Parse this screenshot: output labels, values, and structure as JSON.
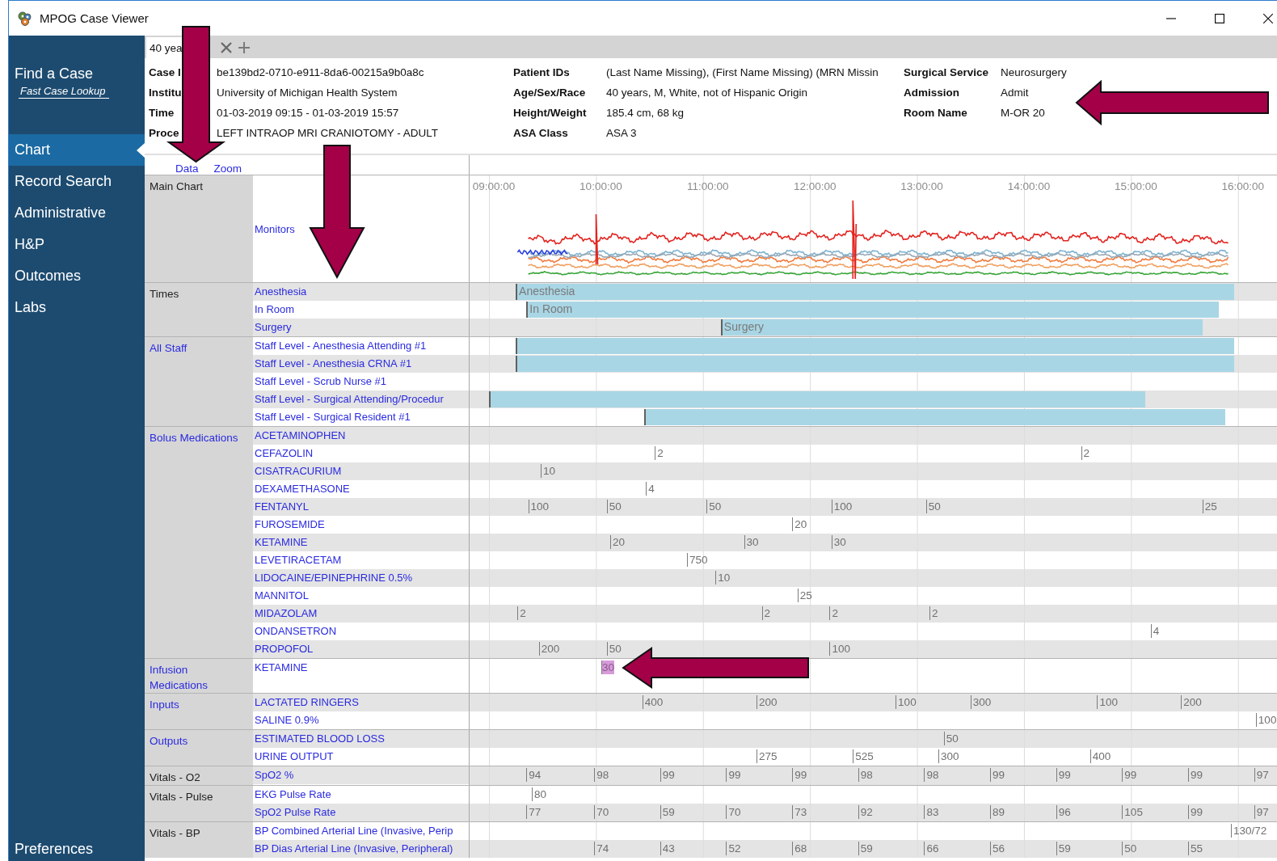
{
  "window": {
    "title": "MPOG Case Viewer"
  },
  "sidebar": {
    "find": {
      "label": "Find a Case",
      "link": "Fast Case Lookup"
    },
    "items": [
      {
        "label": "Chart",
        "selected": true
      },
      {
        "label": "Record Search",
        "selected": false
      },
      {
        "label": "Administrative",
        "selected": false
      },
      {
        "label": "H&P",
        "selected": false
      },
      {
        "label": "Outcomes",
        "selected": false
      },
      {
        "label": "Labs",
        "selected": false
      }
    ],
    "footer": "Preferences"
  },
  "tabs": [
    {
      "label": "40 yea",
      "selected": true
    }
  ],
  "header": {
    "columns": [
      [
        {
          "label": "Case I",
          "value": "be139bd2-0710-e911-8da6-00215a9b0a8c"
        },
        {
          "label": "Institu",
          "value": "University of Michigan Health System"
        },
        {
          "label": "Time",
          "value": "01-03-2019 09:15 - 01-03-2019 15:57"
        },
        {
          "label": "Proce",
          "value": "LEFT INTRAOP MRI CRANIOTOMY - ADULT"
        }
      ],
      [
        {
          "label": "Patient IDs",
          "value": "(Last Name Missing), (First Name Missing) (MRN Missin"
        },
        {
          "label": "Age/Sex/Race",
          "value": "40 years, M, White, not of Hispanic Origin"
        },
        {
          "label": "Height/Weight",
          "value": "185.4 cm, 68 kg"
        },
        {
          "label": "ASA Class",
          "value": "ASA 3"
        }
      ],
      [
        {
          "label": "Surgical Service",
          "value": "Neurosurgery"
        },
        {
          "label": "Admission",
          "value": "Admit"
        },
        {
          "label": "Room Name",
          "value": "M-OR 20"
        }
      ]
    ]
  },
  "chart": {
    "links": [
      "Data",
      "Zoom"
    ],
    "axis": [
      "09:00:00",
      "10:00:00",
      "11:00:00",
      "12:00:00",
      "13:00:00",
      "14:00:00",
      "15:00:00",
      "16:00:00"
    ],
    "main": {
      "group": "Main Chart",
      "label": "Monitors"
    },
    "groups": [
      {
        "name": "Times",
        "clickable": false,
        "rows": [
          {
            "label": "Anesthesia",
            "kind": "interval",
            "text": "Anesthesia"
          },
          {
            "label": "In Room",
            "kind": "interval",
            "text": "In Room"
          },
          {
            "label": "Surgery",
            "kind": "interval",
            "text": "Surgery"
          }
        ]
      },
      {
        "name": "All Staff",
        "clickable": true,
        "rows": [
          {
            "label": "Staff Level - Anesthesia Attending #1",
            "kind": "interval"
          },
          {
            "label": "Staff Level - Anesthesia CRNA #1",
            "kind": "interval"
          },
          {
            "label": "Staff Level - Scrub Nurse #1",
            "kind": "events"
          },
          {
            "label": "Staff Level - Surgical Attending/Procedur",
            "kind": "interval"
          },
          {
            "label": "Staff Level - Surgical Resident #1",
            "kind": "interval"
          }
        ]
      },
      {
        "name": "Bolus Medications",
        "clickable": true,
        "rows": [
          {
            "label": "ACETAMINOPHEN",
            "kind": "events"
          },
          {
            "label": "CEFAZOLIN",
            "kind": "events",
            "values": [
              "2",
              "2"
            ]
          },
          {
            "label": "CISATRACURIUM",
            "kind": "events",
            "values": [
              "10"
            ]
          },
          {
            "label": "DEXAMETHASONE",
            "kind": "events",
            "values": [
              "4"
            ]
          },
          {
            "label": "FENTANYL",
            "kind": "events",
            "values": [
              "100",
              "50",
              "50",
              "100",
              "50",
              "25"
            ]
          },
          {
            "label": "FUROSEMIDE",
            "kind": "events",
            "values": [
              "20"
            ]
          },
          {
            "label": "KETAMINE",
            "kind": "events",
            "values": [
              "20",
              "30",
              "30"
            ]
          },
          {
            "label": "LEVETIRACETAM",
            "kind": "events",
            "values": [
              "750"
            ]
          },
          {
            "label": "LIDOCAINE/EPINEPHRINE 0.5%",
            "kind": "events",
            "values": [
              "10"
            ]
          },
          {
            "label": "MANNITOL",
            "kind": "events",
            "values": [
              "25"
            ]
          },
          {
            "label": "MIDAZOLAM",
            "kind": "events",
            "values": [
              "2",
              "2",
              "2",
              "2"
            ]
          },
          {
            "label": "ONDANSETRON",
            "kind": "events",
            "values": [
              "4"
            ]
          },
          {
            "label": "PROPOFOL",
            "kind": "events",
            "values": [
              "200",
              "50",
              "100"
            ]
          }
        ]
      },
      {
        "name": "Infusion Medications",
        "clickable": true,
        "rows": [
          {
            "label": "KETAMINE",
            "kind": "infusion",
            "values": [
              "30"
            ]
          }
        ]
      },
      {
        "name": "Inputs",
        "clickable": true,
        "rows": [
          {
            "label": "LACTATED RINGERS",
            "kind": "events",
            "values": [
              "400",
              "200",
              "100",
              "300",
              "100",
              "200"
            ]
          },
          {
            "label": "SALINE 0.9%",
            "kind": "events",
            "values": [
              "100"
            ]
          }
        ]
      },
      {
        "name": "Outputs",
        "clickable": true,
        "rows": [
          {
            "label": "ESTIMATED BLOOD LOSS",
            "kind": "events",
            "values": [
              "50"
            ]
          },
          {
            "label": "URINE OUTPUT",
            "kind": "events",
            "values": [
              "275",
              "525",
              "300",
              "400"
            ]
          }
        ]
      },
      {
        "name": "Vitals - O2",
        "clickable": false,
        "rows": [
          {
            "label": "SpO2 %",
            "kind": "events",
            "values": [
              "94",
              "98",
              "99",
              "99",
              "99",
              "98",
              "98",
              "99",
              "99",
              "99",
              "99",
              "97"
            ]
          }
        ]
      },
      {
        "name": "Vitals - Pulse",
        "clickable": false,
        "rows": [
          {
            "label": "EKG Pulse Rate",
            "kind": "events",
            "values": [
              "80"
            ]
          },
          {
            "label": "SpO2 Pulse Rate",
            "kind": "events",
            "values": [
              "77",
              "70",
              "59",
              "70",
              "73",
              "92",
              "83",
              "89",
              "96",
              "105",
              "99",
              "97"
            ]
          }
        ]
      },
      {
        "name": "Vitals - BP",
        "clickable": false,
        "rows": [
          {
            "label": "BP Combined Arterial Line (Invasive, Perip",
            "kind": "events",
            "values": [
              "130/72"
            ]
          },
          {
            "label": "BP Dias Arterial Line (Invasive, Peripheral)",
            "kind": "events",
            "values": [
              "74",
              "43",
              "52",
              "68",
              "59",
              "66",
              "56",
              "59",
              "50",
              "55"
            ]
          }
        ]
      }
    ]
  }
}
